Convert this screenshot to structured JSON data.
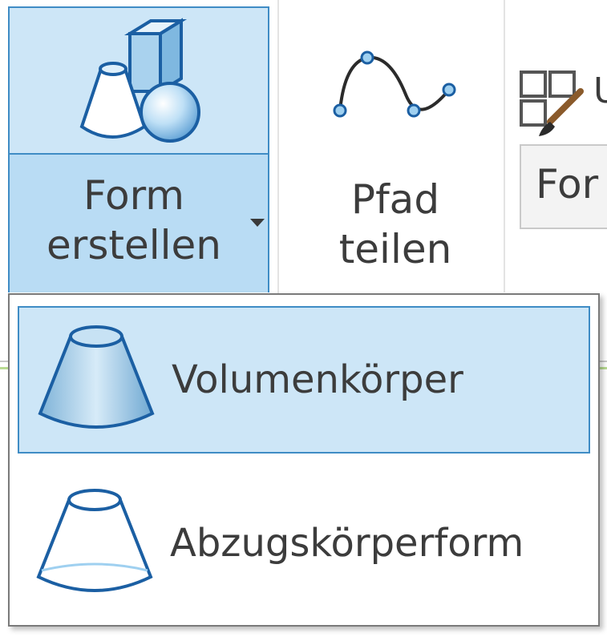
{
  "ribbon": {
    "form_button": {
      "label": "Form erstellen"
    },
    "pfad_button": {
      "label": "Pfad teilen"
    },
    "cut_off_label": "U",
    "form_combo_text": "For"
  },
  "dropdown": {
    "items": [
      {
        "label": "Volumenkörper",
        "selected": true
      },
      {
        "label": "Abzugskörperform",
        "selected": false
      }
    ]
  },
  "colors": {
    "hover_fill": "#cde6f7",
    "hover_border": "#3f8cc5"
  }
}
